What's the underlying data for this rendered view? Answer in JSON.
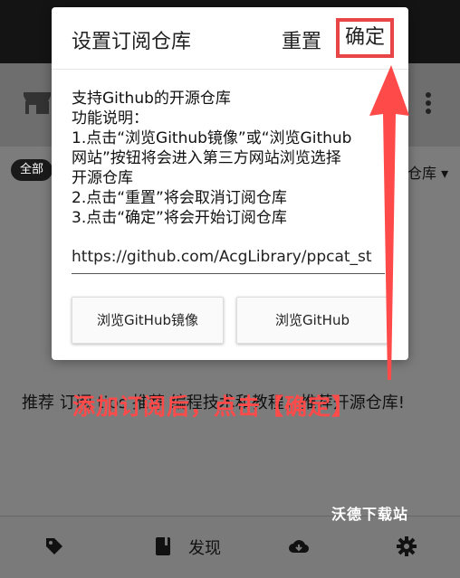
{
  "background": {
    "chip_all": "全部",
    "repo_dropdown": "仓库 ▾",
    "recommend_text": "推荐 订阅 tips 推荐 编程技术和教程，推荐开源仓库!",
    "nav": {
      "discover_label": "发现"
    },
    "watermark": "沃德下载站"
  },
  "dialog": {
    "title": "设置订阅仓库",
    "reset_label": "重置",
    "confirm_label": "确定",
    "body_lines": [
      "支持Github的开源仓库",
      "功能说明：",
      "1.点击“浏览Github镜像”或“浏览Github",
      "网站”按钮将会进入第三方网站浏览选择",
      "开源仓库",
      "2.点击“重置”将会取消订阅仓库",
      "3.点击“确定”将会开始订阅仓库"
    ],
    "url_value": "https://github.com/AcgLibrary/ppcat_st",
    "button_mirror": "浏览GitHub镜像",
    "button_site": "浏览GitHub"
  },
  "annotation": {
    "text": "添加订阅后，点击【确定】",
    "color": "#ff4a4a"
  },
  "colors": {
    "highlight_border": "#e84646"
  }
}
